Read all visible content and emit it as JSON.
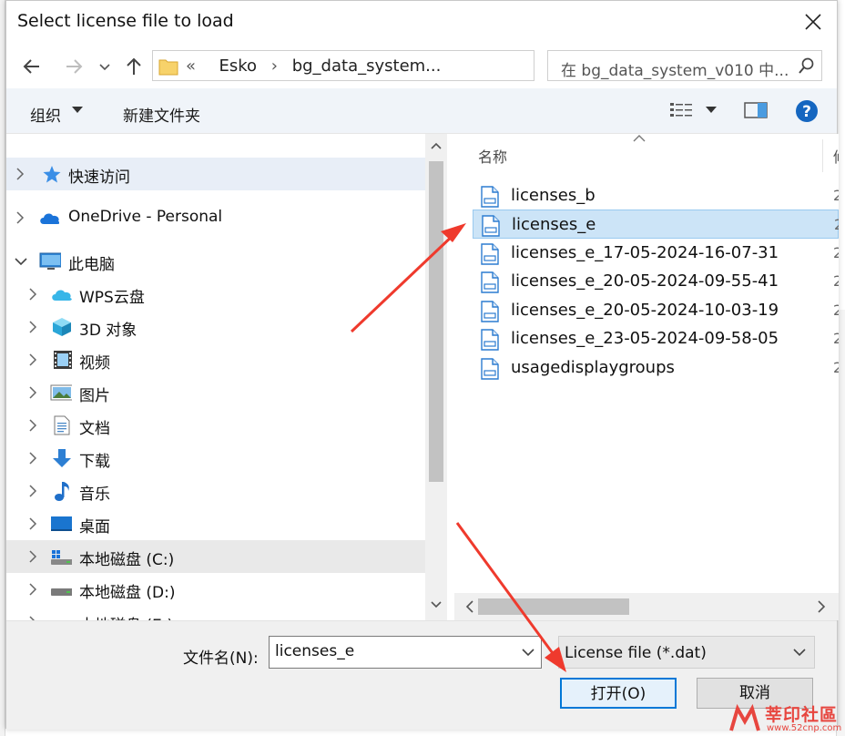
{
  "window": {
    "title": "Select license file to load"
  },
  "address_bar": {
    "prefix": "«",
    "crumbs": [
      "Esko",
      "bg_data_system..."
    ]
  },
  "search": {
    "placeholder": "在 bg_data_system_v010 中..."
  },
  "toolbar": {
    "organize_label": "组织",
    "new_folder_label": "新建文件夹"
  },
  "nav_pane": {
    "items": [
      {
        "label": "快速访问",
        "icon": "star-icon"
      },
      {
        "label": "OneDrive - Personal",
        "icon": "cloud-icon"
      },
      {
        "label": "此电脑",
        "icon": "computer-icon"
      },
      {
        "label": "WPS云盘",
        "icon": "wps-cloud-icon"
      },
      {
        "label": "3D 对象",
        "icon": "cube-icon"
      },
      {
        "label": "视频",
        "icon": "video-icon"
      },
      {
        "label": "图片",
        "icon": "picture-icon"
      },
      {
        "label": "文档",
        "icon": "document-icon"
      },
      {
        "label": "下载",
        "icon": "download-icon"
      },
      {
        "label": "音乐",
        "icon": "music-icon"
      },
      {
        "label": "桌面",
        "icon": "desktop-icon"
      },
      {
        "label": "本地磁盘 (C:)",
        "icon": "drive-c-icon"
      },
      {
        "label": "本地磁盘 (D:)",
        "icon": "drive-icon"
      },
      {
        "label": "本地磁盘 (E:)",
        "icon": "drive-icon"
      }
    ]
  },
  "file_list": {
    "column_name": "名称",
    "column_next_stub": "修",
    "date_stub": "2",
    "files": [
      "licenses_b",
      "licenses_e",
      "licenses_e_17-05-2024-16-07-31",
      "licenses_e_20-05-2024-09-55-41",
      "licenses_e_20-05-2024-10-03-19",
      "licenses_e_23-05-2024-09-58-05",
      "usagedisplaygroups"
    ],
    "selected_index": 1
  },
  "bottom": {
    "filename_label": "文件名(N):",
    "filename_value": "licenses_e",
    "filetype_value": "License file (*.dat)",
    "open_label": "打开(O)",
    "cancel_label": "取消"
  },
  "watermark": {
    "text": "莘印社區",
    "url": "www.52cnp.com"
  },
  "colors": {
    "accent": "#0078d7",
    "selection": "#cce4f7",
    "annotation_arrow": "#ef3a2d"
  }
}
